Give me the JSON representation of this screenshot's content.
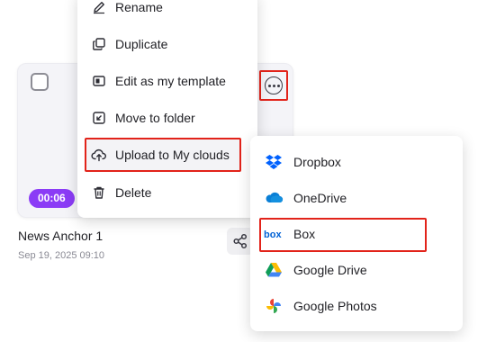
{
  "card": {
    "duration": "00:06",
    "title": "News Anchor 1",
    "date": "Sep 19, 2025 09:10"
  },
  "menu": {
    "items": [
      {
        "label": "Rename",
        "icon": "pencil-icon"
      },
      {
        "label": "Duplicate",
        "icon": "duplicate-icon"
      },
      {
        "label": "Edit as my template",
        "icon": "template-icon"
      },
      {
        "label": "Move to folder",
        "icon": "move-folder-icon"
      },
      {
        "label": "Upload to My clouds",
        "icon": "cloud-upload-icon",
        "highlighted": true
      },
      {
        "label": "Delete",
        "icon": "trash-icon"
      }
    ]
  },
  "submenu": {
    "items": [
      {
        "label": "Dropbox",
        "icon": "dropbox-icon"
      },
      {
        "label": "OneDrive",
        "icon": "onedrive-icon"
      },
      {
        "label": "Box",
        "icon": "box-icon",
        "highlighted": true
      },
      {
        "label": "Google Drive",
        "icon": "google-drive-icon"
      },
      {
        "label": "Google Photos",
        "icon": "google-photos-icon"
      }
    ]
  },
  "colors": {
    "accent": "#8b3cf6",
    "highlight_border": "#e2231a",
    "dropbox": "#0061fe",
    "onedrive": "#0364b8",
    "box": "#0061d5"
  }
}
